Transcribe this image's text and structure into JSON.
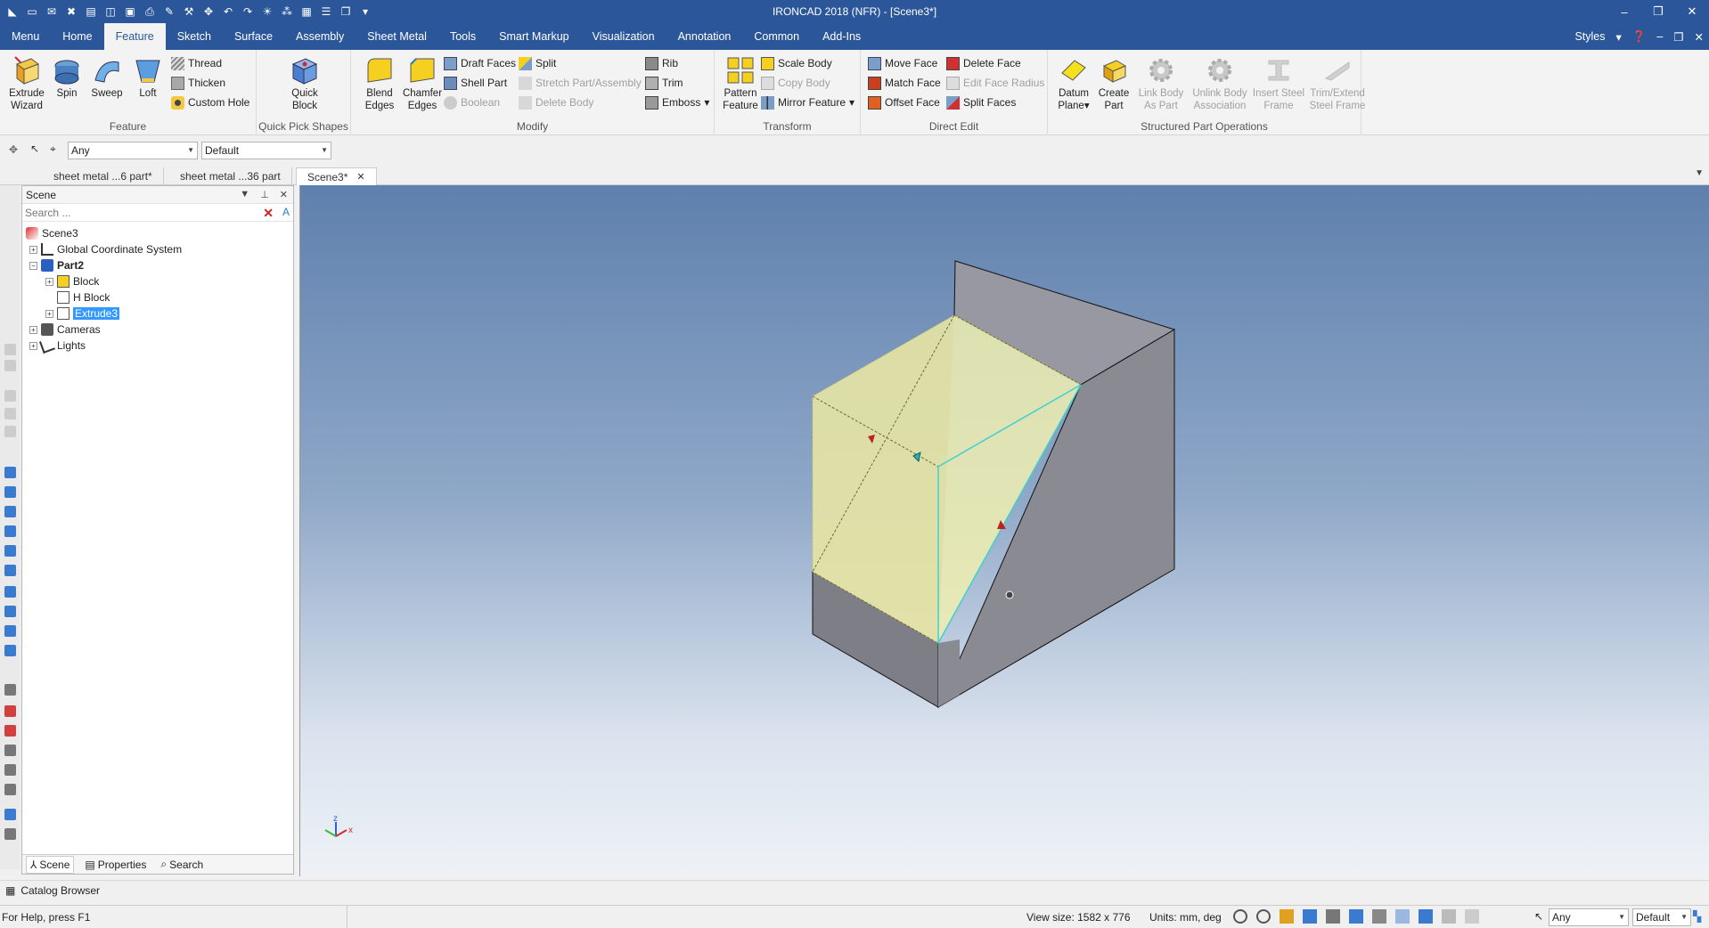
{
  "window": {
    "title": "IRONCAD 2018 (NFR) - [Scene3*]",
    "controls": [
      "–",
      "❐",
      "✕"
    ]
  },
  "tabs": [
    "Menu",
    "Home",
    "Feature",
    "Sketch",
    "Surface",
    "Assembly",
    "Sheet Metal",
    "Tools",
    "Smart Markup",
    "Visualization",
    "Annotation",
    "Common",
    "Add-Ins"
  ],
  "active_tab": "Feature",
  "styles_label": "Styles",
  "ribbon": {
    "feature": {
      "label": "Feature",
      "extrude": [
        "Extrude",
        "Wizard"
      ],
      "spin": "Spin",
      "sweep": "Sweep",
      "loft": "Loft",
      "thread": "Thread",
      "thicken": "Thicken",
      "custom_hole": "Custom Hole"
    },
    "quick_pick": {
      "label": "Quick Pick Shapes",
      "quick_block": [
        "Quick",
        "Block"
      ]
    },
    "modify": {
      "label": "Modify",
      "blend": [
        "Blend",
        "Edges"
      ],
      "chamfer": [
        "Chamfer",
        "Edges"
      ],
      "draft_faces": "Draft Faces",
      "shell_part": "Shell Part",
      "boolean": "Boolean",
      "split": "Split",
      "stretch": "Stretch Part/Assembly",
      "delete_body": "Delete Body",
      "rib": "Rib",
      "trim": "Trim",
      "emboss": "Emboss"
    },
    "transform": {
      "label": "Transform",
      "pattern": [
        "Pattern",
        "Feature"
      ],
      "scale_body": "Scale Body",
      "copy_body": "Copy Body",
      "mirror_feature": "Mirror Feature"
    },
    "direct_edit": {
      "label": "Direct Edit",
      "move_face": "Move Face",
      "match_face": "Match Face",
      "offset_face": "Offset Face",
      "delete_face": "Delete Face",
      "edit_face_radius": "Edit Face Radius",
      "split_faces": "Split Faces"
    },
    "structured": {
      "label": "Structured Part Operations",
      "datum_plane": [
        "Datum",
        "Plane"
      ],
      "create_part": [
        "Create",
        "Part"
      ],
      "link_body": [
        "Link Body",
        "As Part"
      ],
      "unlink_body": [
        "Unlink Body",
        "Association"
      ],
      "insert_steel": [
        "Insert Steel",
        "Frame"
      ],
      "trim_extend": [
        "Trim/Extend",
        "Steel Frame"
      ]
    }
  },
  "selection_bar": {
    "filter": "Any",
    "style": "Default"
  },
  "doc_tabs": [
    "sheet metal ...6 part*",
    "sheet metal ...36 part",
    "Scene3*"
  ],
  "scene_panel": {
    "title": "Scene",
    "search_placeholder": "Search ...",
    "tree": [
      {
        "label": "Scene3",
        "level": 0,
        "expander": "",
        "bold": false,
        "selected": false
      },
      {
        "label": "Global Coordinate System",
        "level": 1,
        "expander": "+",
        "bold": false,
        "selected": false
      },
      {
        "label": "Part2",
        "level": 1,
        "expander": "−",
        "bold": true,
        "selected": false
      },
      {
        "label": "Block",
        "level": 2,
        "expander": "+",
        "bold": false,
        "selected": false
      },
      {
        "label": "H Block",
        "level": 2,
        "expander": "",
        "bold": false,
        "selected": false
      },
      {
        "label": "Extrude3",
        "level": 2,
        "expander": "+",
        "bold": false,
        "selected": true
      },
      {
        "label": "Cameras",
        "level": 1,
        "expander": "+",
        "bold": false,
        "selected": false
      },
      {
        "label": "Lights",
        "level": 1,
        "expander": "+",
        "bold": false,
        "selected": false
      }
    ],
    "footer_tabs": [
      "Scene",
      "Properties",
      "Search"
    ]
  },
  "axis_triad": {
    "z": "z",
    "x": "x"
  },
  "catalog_label": "Catalog Browser",
  "status": {
    "help": "For Help, press F1",
    "view_size": "View size: 1582 x  776",
    "units": "Units: mm, deg",
    "filter": "Any",
    "style": "Default"
  },
  "colors": {
    "title_bar": "#2b579a",
    "selected_face": "#f0efb0",
    "body_gray": "#8e8e96",
    "highlight_edge": "#40d0d0"
  }
}
